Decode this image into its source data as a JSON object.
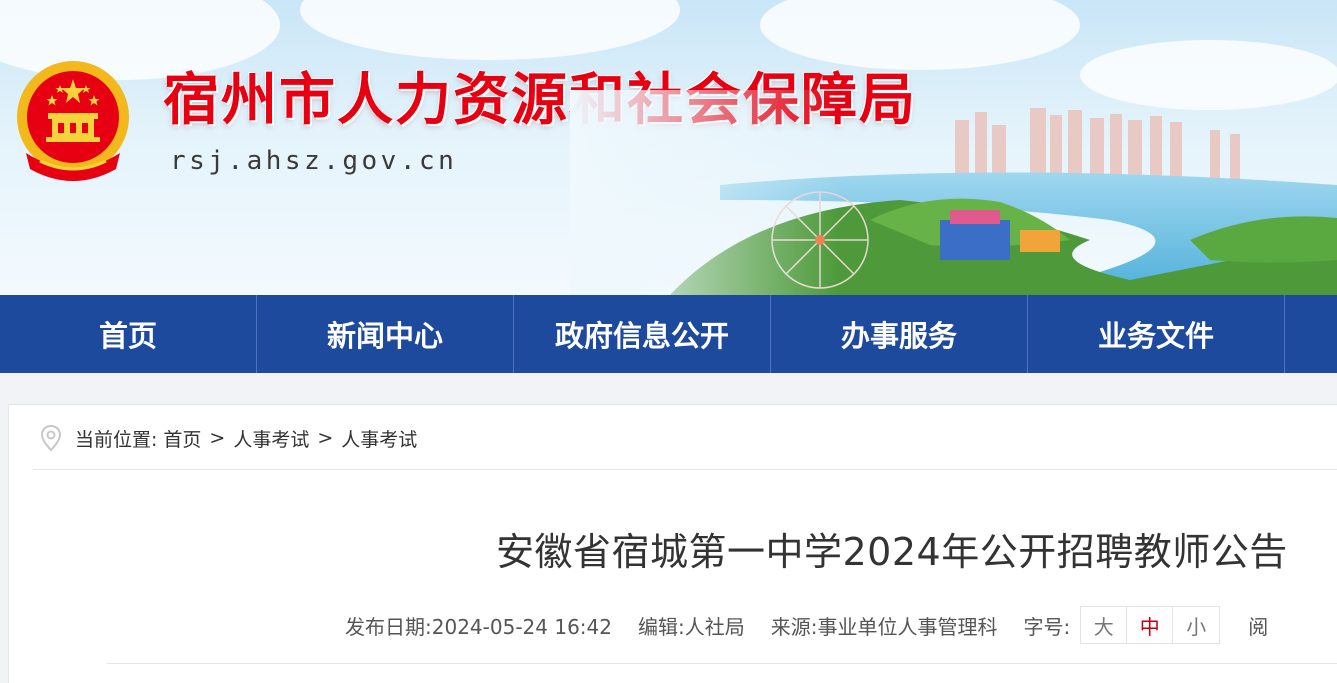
{
  "site": {
    "title": "宿州市人力资源和社会保障局",
    "domain": "rsj.ahsz.gov.cn"
  },
  "nav": {
    "items": [
      "首页",
      "新闻中心",
      "政府信息公开",
      "办事服务",
      "业务文件",
      ""
    ]
  },
  "breadcrumb": {
    "label": "当前位置:",
    "items": [
      "首页",
      "人事考试",
      "人事考试"
    ],
    "separator": ">"
  },
  "article": {
    "title": "安徽省宿城第一中学2024年公开招聘教师公告",
    "meta": {
      "date_label": "发布日期:",
      "date_value": "2024-05-24 16:42",
      "editor_label": "编辑:",
      "editor_value": "人社局",
      "source_label": "来源:",
      "source_value": "事业单位人事管理科",
      "fontsize_label": "字号:",
      "fontsize_options": [
        "大",
        "中",
        "小"
      ],
      "fontsize_selected": "中",
      "truncated_text": "阅"
    }
  },
  "colors": {
    "nav_bg": "#1e4a9e",
    "title_red": "#e60012",
    "active_size": "#c7000b"
  }
}
